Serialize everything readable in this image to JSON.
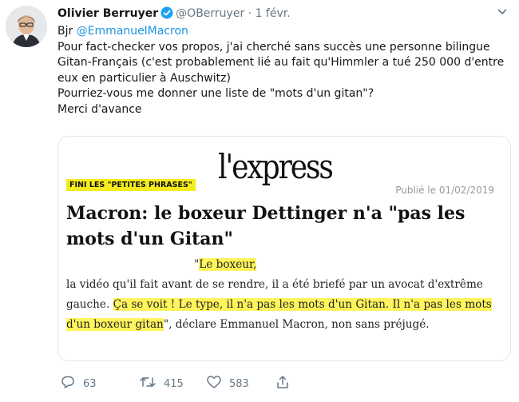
{
  "tweet": {
    "author_name": "Olivier Berruyer",
    "handle": "@OBerruyer",
    "separator": "·",
    "date": "1 févr.",
    "greeting": "Bjr",
    "mention": "@EmmanuelMacron",
    "line1": "Pour fact-checker vos propos, j'ai cherché sans succès une personne bilingue Gitan-Français (c'est probablement lié au fait qu'Himmler a tué 250 000 d'entre eux en particulier à Auschwitz)",
    "line2": "Pourriez-vous me donner une liste de \"mots d'un gitan\"?",
    "line3": "Merci d'avance"
  },
  "card": {
    "logo": "l'express",
    "tag": "FINI LES \"PETITES PHRASES\"",
    "published": "Publié le 01/02/2019",
    "headline": "Macron: le boxeur Dettinger n'a \"pas les mots d'un Gitan\"",
    "quote_open": "\"",
    "quote_hl1": "Le boxeur,",
    "body_plain1": "la vidéo qu'il fait avant de se rendre, il a été briefé par un avocat d'extrême gauche.",
    "quote_hl2": "Ça se voit ! Le type, il n'a pas les mots d'un Gitan. Il n'a pas les mots d'un boxeur gitan",
    "body_plain2": "\", déclare Emmanuel Macron, non sans préjugé."
  },
  "actions": {
    "replies": "63",
    "retweets": "415",
    "likes": "583"
  },
  "icons": {
    "verified": "verified-badge-icon",
    "caret": "chevron-down-icon",
    "reply": "reply-icon",
    "retweet": "retweet-icon",
    "like": "heart-icon",
    "share": "share-icon"
  },
  "colors": {
    "link": "#1b95e0",
    "muted": "#657786",
    "highlight": "#fff45c",
    "tag_bg": "#f5ec1f"
  }
}
